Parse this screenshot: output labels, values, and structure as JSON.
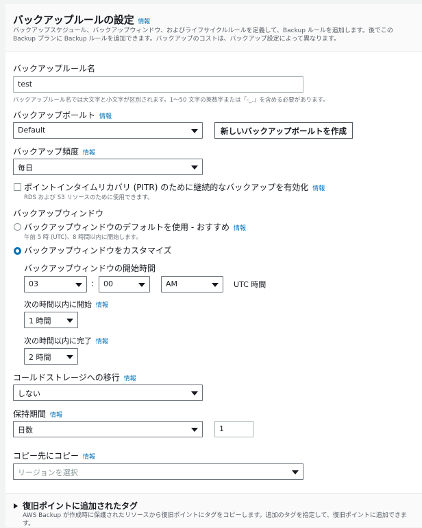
{
  "header": {
    "title": "バックアップルールの設定",
    "info": "情報",
    "description": "バックアップスケジュール、バックアップウィンドウ、およびライフサイクルルールを定義して、Backup ルールを追加します。後でこの Backup プランに Backup ルールを追加できます。バックアップのコストは、バックアップ設定によって異なります。"
  },
  "rule_name": {
    "label": "バックアップルール名",
    "value": "test",
    "hint": "バックアップルール名では大文字と小文字が区別されます。1～50 文字の英数字または「-_.」を含める必要があります。"
  },
  "vault": {
    "label": "バックアップボールト",
    "info": "情報",
    "value": "Default",
    "create_button": "新しいバックアップボールトを作成"
  },
  "frequency": {
    "label": "バックアップ頻度",
    "info": "情報",
    "value": "毎日"
  },
  "pitr": {
    "label": "ポイントインタイムリカバリ (PITR) のために継続的なバックアップを有効化",
    "info": "情報",
    "hint": "RDS および S3 リソースのために使用できます。",
    "checked": false
  },
  "window": {
    "label": "バックアップウィンドウ",
    "default_option": {
      "label": "バックアップウィンドウのデフォルトを使用 - おすすめ",
      "info": "情報",
      "hint": "午前 5 時 (UTC)、8 時間以内に開始します。",
      "checked": false
    },
    "custom_option": {
      "label": "バックアップウィンドウをカスタマイズ",
      "checked": true
    },
    "start_time_label": "バックアップウィンドウの開始時間",
    "hour": "03",
    "colon": ":",
    "minute": "00",
    "ampm": "AM",
    "tz": "UTC 時間",
    "start_within_label": "次の時間以内に開始",
    "start_within_info": "情報",
    "start_within_value": "1 時間",
    "complete_within_label": "次の時間以内に完了",
    "complete_within_info": "情報",
    "complete_within_value": "2 時間"
  },
  "cold_storage": {
    "label": "コールドストレージへの移行",
    "info": "情報",
    "value": "しない"
  },
  "retention": {
    "label": "保持期間",
    "info": "情報",
    "unit": "日数",
    "value": "1"
  },
  "copy": {
    "label": "コピー先にコピー",
    "info": "情報",
    "placeholder": "リージョンを選択"
  },
  "tags": {
    "title": "復旧ポイントに追加されたタグ",
    "description": "AWS Backup が作成時に保護されたリソースから復旧ポイントにタグをコピーします。追加のタグを指定して、復旧ポイントに追加できます。"
  }
}
